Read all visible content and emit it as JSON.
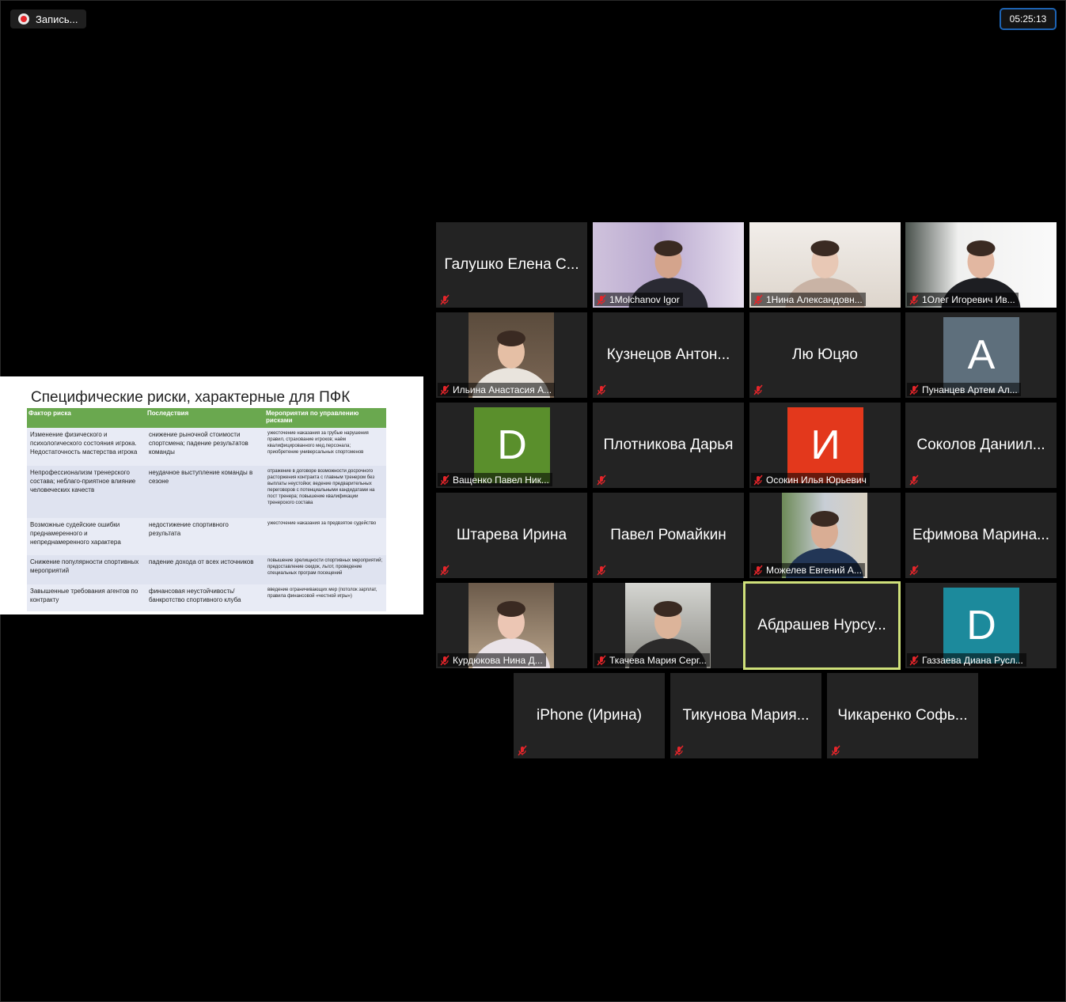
{
  "recording": {
    "label": "Запись..."
  },
  "timer": "05:25:13",
  "slide": {
    "title": "Специфические риски, характерные для ПФК",
    "headers": [
      "Фактор риска",
      "Последствия",
      "Мероприятия по управлению рисками"
    ],
    "rows": [
      [
        "Изменение физического и психологического состояния игрока. Недостаточность мастерства игрока",
        "снижение рыночной стоимости спортсмена; падение результатов команды",
        "ужесточение наказания за грубые нарушения правил, страхование игроков; наём квалифицированного мед.персонала; приобретение универсальных спортсменов"
      ],
      [
        "Непрофессионализм тренерского состава; неблаго-приятное влияние человеческих качеств",
        "неудачное выступление команды в сезоне",
        "отражение в договоре возможности досрочного расторжения контракта с главным тренером без выплаты неустойки; ведение предварительных переговоров с потенциальными кандидатами на пост тренера; повышение квалификации тренерского состава"
      ],
      [
        "Возможные судейские ошибки преднамеренного и непреднамеренного характера",
        "недостижение спортивного результата",
        "ужесточение наказания за предвзятое судейство"
      ],
      [
        "Снижение популярности спортивных мероприятий",
        "падение дохода от всех источников",
        "повышение зрелищности спортивных мероприятий; предоставление скидок, льгот, проведение специальных програм посещений"
      ],
      [
        "Завышенные требования агентов по контракту",
        "финансовая неустойчивость/ банкротство спортивного клуба",
        "введение ограничивающих мер (потолок зарплат, правила финансовой «честной игры»)"
      ]
    ]
  },
  "participants": [
    {
      "name": "Галушко Елена С...",
      "type": "name",
      "caption": ""
    },
    {
      "name": "1Molchanov Igor",
      "type": "video",
      "caption": "1Molchanov Igor"
    },
    {
      "name": "1Нина Александовн...",
      "type": "video",
      "caption": "1Нина Александовн..."
    },
    {
      "name": "1Олег Игоревич Ив...",
      "type": "video",
      "caption": "1Олег Игоревич Ив..."
    },
    {
      "name": "Ильина Анастасия А...",
      "type": "video",
      "caption": "Ильина Анастасия А..."
    },
    {
      "name": "Кузнецов Антон...",
      "type": "name",
      "caption": ""
    },
    {
      "name": "Лю Юцяо",
      "type": "name",
      "caption": ""
    },
    {
      "name": "Пунанцев Артем Ал...",
      "type": "avatar",
      "letter": "A",
      "color": "#5e6f7c",
      "caption": "Пунанцев Артем Ал..."
    },
    {
      "name": "Ващенко Павел Ник...",
      "type": "avatar",
      "letter": "D",
      "color": "#5a8f2c",
      "caption": "Ващенко Павел Ник..."
    },
    {
      "name": "Плотникова Дарья",
      "type": "name",
      "caption": ""
    },
    {
      "name": "Осокин Илья Юрьевич",
      "type": "avatar",
      "letter": "И",
      "color": "#e3381c",
      "caption": "Осокин Илья Юрьевич"
    },
    {
      "name": "Соколов Даниил...",
      "type": "name",
      "caption": ""
    },
    {
      "name": "Штарева Ирина",
      "type": "name",
      "caption": ""
    },
    {
      "name": "Павел Ромайкин",
      "type": "name",
      "caption": ""
    },
    {
      "name": "Можелев Евгений А...",
      "type": "video",
      "caption": "Можелев Евгений А..."
    },
    {
      "name": "Ефимова Марина...",
      "type": "name",
      "caption": ""
    },
    {
      "name": "Курдюкова Нина Д...",
      "type": "video",
      "caption": "Курдюкова Нина Д..."
    },
    {
      "name": "Ткачева Мария Серг...",
      "type": "video",
      "caption": "Ткачева Мария Серг..."
    },
    {
      "name": "Абдрашев Нурсу...",
      "type": "name",
      "caption": "",
      "active": true
    },
    {
      "name": "Газзаева Диана Русл...",
      "type": "avatar",
      "letter": "D",
      "color": "#1c8a9c",
      "caption": "Газзаева Диана Русл..."
    },
    {
      "name": "iPhone (Ирина)",
      "type": "name",
      "caption": ""
    },
    {
      "name": "Тикунова Мария...",
      "type": "name",
      "caption": ""
    },
    {
      "name": "Чикаренко Софь...",
      "type": "name",
      "caption": ""
    }
  ],
  "colors": {
    "tile_bg": "#232323",
    "active_border": "#cfe07a",
    "mic_muted": "#e5252a",
    "timer_border": "#1d63b3"
  }
}
